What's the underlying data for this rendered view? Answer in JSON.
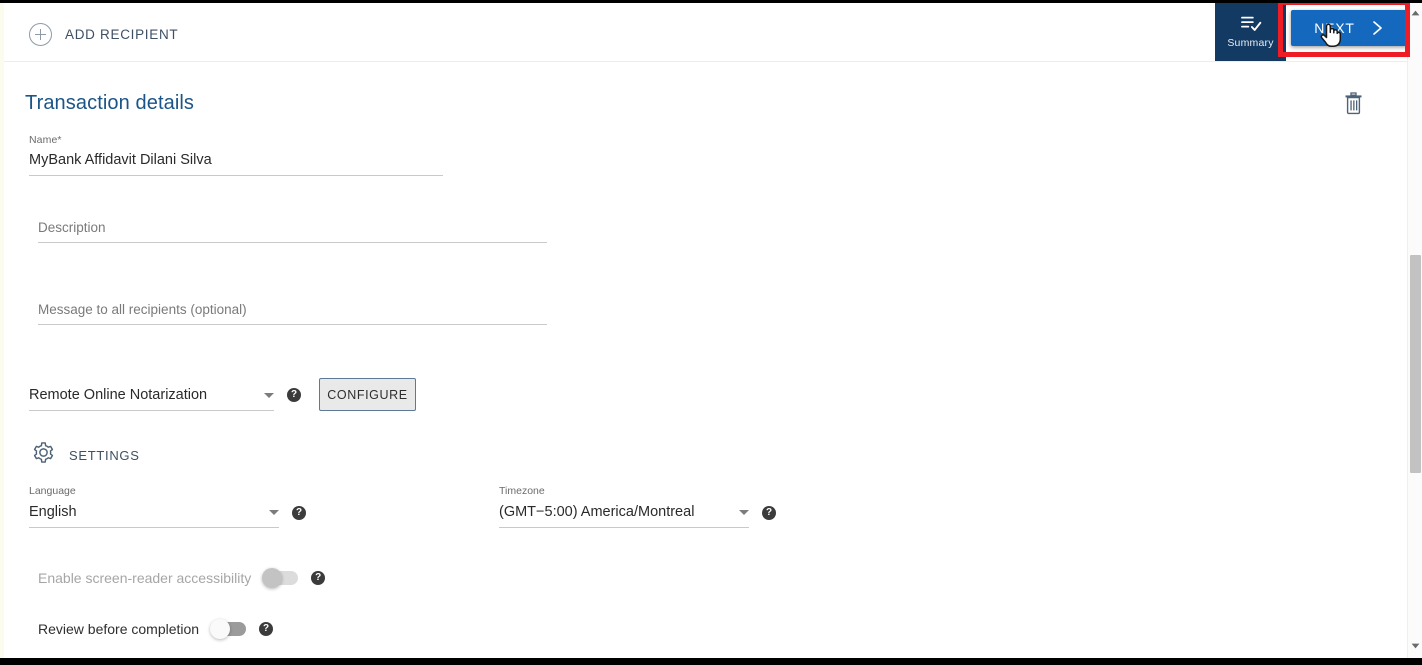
{
  "topbar": {
    "add_recipient_label": "ADD RECIPIENT",
    "add_recipient_icon": "plus-circle-icon",
    "summary_label": "Summary",
    "summary_icon": "list-check-icon",
    "next_label": "NEXT",
    "next_icon": "chevron-right-icon",
    "summary_bg": "#123a63",
    "next_bg": "#1469be"
  },
  "annotation": {
    "highlight_color": "#ee1c25",
    "cursor_icon": "pointing-hand-cursor"
  },
  "form": {
    "section_title": "Transaction details",
    "delete_icon": "trash-icon",
    "name": {
      "label": "Name",
      "required_marker": "*",
      "value": "MyBank Affidavit Dilani Silva"
    },
    "description": {
      "placeholder": "Description",
      "value": ""
    },
    "message": {
      "placeholder": "Message to all recipients (optional)",
      "value": ""
    },
    "notarization": {
      "value": "Remote Online Notarization",
      "help_icon": "help-icon",
      "configure_label": "CONFIGURE"
    }
  },
  "settings": {
    "header_label": "SETTINGS",
    "header_icon": "gear-icon",
    "language": {
      "label": "Language",
      "value": "English",
      "help_icon": "help-icon"
    },
    "timezone": {
      "label": "Timezone",
      "value": "(GMT−5:00) America/Montreal",
      "help_icon": "help-icon"
    },
    "toggles": [
      {
        "label": "Enable screen-reader accessibility",
        "state": "off",
        "disabled": true,
        "help_icon": "help-icon"
      },
      {
        "label": "Review before completion",
        "state": "off",
        "disabled": false,
        "help_icon": "help-icon"
      }
    ]
  },
  "scrollbar": {
    "up_icon": "scroll-up-arrow-icon",
    "down_icon": "scroll-down-arrow-icon"
  }
}
